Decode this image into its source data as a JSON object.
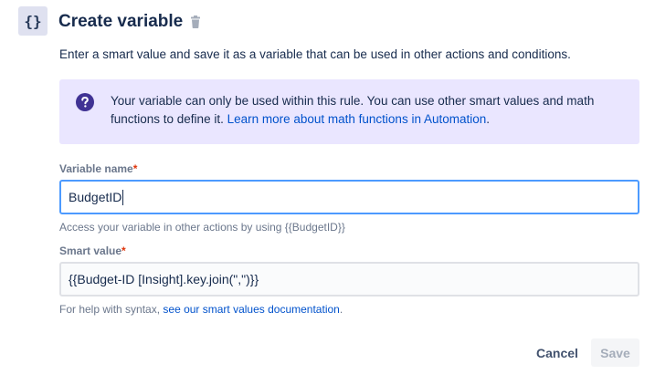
{
  "header": {
    "icon_text": "{}",
    "title": "Create variable"
  },
  "description": "Enter a smart value and save it as a variable that can be used in other actions and conditions.",
  "info": {
    "text": "Your variable can only be used within this rule. You can use other smart values and math functions to define it. ",
    "link": "Learn more about math functions in Automation",
    "suffix": "."
  },
  "variable_name": {
    "label": "Variable name",
    "required_mark": "*",
    "value": "BudgetID",
    "help": "Access your variable in other actions by using {{BudgetID}}"
  },
  "smart_value": {
    "label": "Smart value",
    "required_mark": "*",
    "value": "{{Budget-ID [Insight].key.join(\",\")}}",
    "help_prefix": "For help with syntax, ",
    "help_link": "see our smart values documentation",
    "help_suffix": "."
  },
  "actions": {
    "cancel": "Cancel",
    "save": "Save"
  },
  "colors": {
    "accent": "#0052cc",
    "info_bg": "#eae6ff",
    "info_icon": "#403294",
    "focus_border": "#4c9aff",
    "required": "#de350b"
  },
  "icons": [
    "braces-icon",
    "trash-icon",
    "question-icon"
  ]
}
